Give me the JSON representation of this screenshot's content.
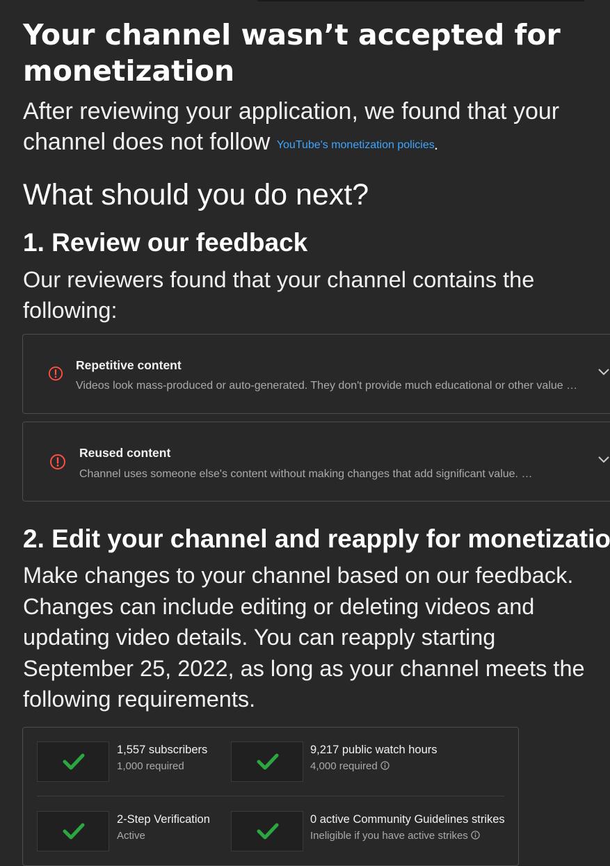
{
  "status": {
    "title": "Your channel wasn’t accepted for monetization",
    "intro_text": "After reviewing your application, we found that your channel does not follow ",
    "policy_link": "YouTube's monetization policies",
    "intro_end": "."
  },
  "next": {
    "heading": "What should you do next?"
  },
  "step1": {
    "heading": "1. Review our feedback",
    "text": "Our reviewers found that your channel contains the following:",
    "items": [
      {
        "title": "Repetitive content",
        "description": "Videos look mass-produced or auto-generated. They don't provide much educational or other value …",
        "icon": "alert-circle-icon",
        "expand_icon": "chevron-down-icon"
      },
      {
        "title": "Reused content",
        "description": "Channel uses someone else's content without making changes that add significant value. …",
        "icon": "alert-circle-icon",
        "expand_icon": "chevron-down-icon"
      }
    ]
  },
  "step2": {
    "heading": "2. Edit your channel and reapply for monetizatio",
    "text": "Make changes to your channel based on our feedback. Changes can include editing or deleting videos and updating video details. You can reapply starting September 25, 2022, as long as your channel meets the following requirements."
  },
  "requirements": [
    {
      "title": "1,557 subscribers",
      "subtitle": "1,000 required",
      "info_icon": false,
      "icon": "check-icon"
    },
    {
      "title": "9,217 public watch hours",
      "subtitle": "4,000 required",
      "info_icon": true,
      "icon": "check-icon"
    },
    {
      "title": "2-Step Verification",
      "subtitle": "Active",
      "info_icon": false,
      "icon": "check-icon"
    },
    {
      "title": "0 active Community Guidelines strikes",
      "subtitle": "Ineligible if you have active strikes",
      "info_icon": true,
      "icon": "check-icon"
    }
  ],
  "colors": {
    "background": "#282828",
    "link": "#3ea6ff",
    "alert": "#ff4e45",
    "check": "#2ba640",
    "muted_text": "#aaaaaa",
    "border": "#4d4d4d"
  }
}
